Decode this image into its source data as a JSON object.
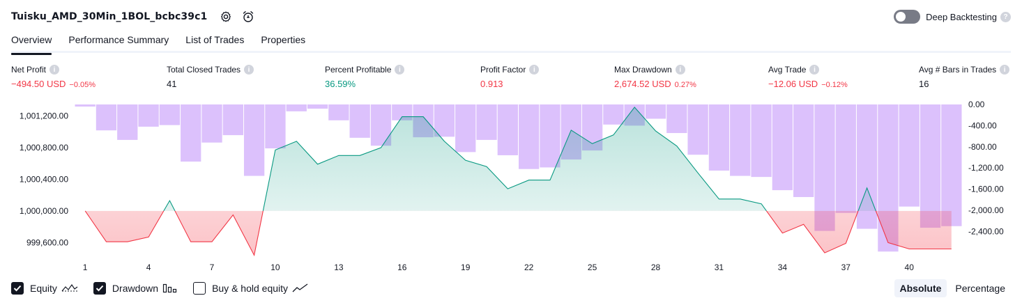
{
  "header": {
    "title": "Tuisku_AMD_30Min_1BOL_bcbc39c1",
    "settings_icon": "gear-icon",
    "alert_icon": "alarm-clock-add-icon",
    "deep_backtesting_label": "Deep Backtesting",
    "deep_backtesting_enabled": false
  },
  "tabs": [
    {
      "label": "Overview",
      "active": true
    },
    {
      "label": "Performance Summary",
      "active": false
    },
    {
      "label": "List of Trades",
      "active": false
    },
    {
      "label": "Properties",
      "active": false
    }
  ],
  "metrics": [
    {
      "label": "Net Profit",
      "value": "−494.50 USD",
      "pct": "−0.05%",
      "tone": "neg"
    },
    {
      "label": "Total Closed Trades",
      "value": "41",
      "pct": "",
      "tone": "neu"
    },
    {
      "label": "Percent Profitable",
      "value": "36.59%",
      "pct": "",
      "tone": "pos"
    },
    {
      "label": "Profit Factor",
      "value": "0.913",
      "pct": "",
      "tone": "neg"
    },
    {
      "label": "Max Drawdown",
      "value": "2,674.52 USD",
      "pct": "0.27%",
      "tone": "neg"
    },
    {
      "label": "Avg Trade",
      "value": "−12.06 USD",
      "pct": "−0.12%",
      "tone": "neg"
    },
    {
      "label": "Avg # Bars in Trades",
      "value": "16",
      "pct": "",
      "tone": "neu"
    }
  ],
  "chart_data": {
    "type": "line",
    "x_ticks": [
      "1",
      "4",
      "7",
      "10",
      "13",
      "16",
      "19",
      "22",
      "25",
      "28",
      "31",
      "34",
      "37",
      "40"
    ],
    "y_left_ticks": [
      "1,001,200.00",
      "1,000,800.00",
      "1,000,400.00",
      "1,000,000.00",
      "999,600.00"
    ],
    "y_right_ticks": [
      "0.00",
      "-400.00",
      "-800.00",
      "-1,200.00",
      "-1,600.00",
      "-2,000.00",
      "-2,400.00"
    ],
    "baseline": 1000000,
    "ylim_left": [
      999480,
      1001345
    ],
    "ylim_right": [
      -2790,
      0
    ],
    "series": [
      {
        "name": "Equity",
        "color_up": "#089981",
        "color_down": "#f23645",
        "x": [
          1,
          2,
          3,
          4,
          5,
          6,
          7,
          8,
          9,
          10,
          11,
          12,
          13,
          14,
          15,
          16,
          17,
          18,
          19,
          20,
          21,
          22,
          23,
          24,
          25,
          26,
          27,
          28,
          29,
          30,
          31,
          32,
          33,
          34,
          35,
          36,
          37,
          38,
          39,
          40,
          41,
          42
        ],
        "values": [
          1000000,
          999610,
          999610,
          999670,
          1000130,
          999610,
          999610,
          999950,
          999440,
          1000770,
          1000880,
          1000590,
          1000700,
          1000700,
          1000800,
          1001190,
          1001190,
          1000880,
          1000640,
          1000560,
          1000280,
          1000390,
          1000390,
          1001020,
          1000850,
          1000960,
          1001310,
          1001010,
          1000820,
          1000480,
          1000150,
          1000150,
          1000090,
          999720,
          999830,
          999470,
          999590,
          1000290,
          999600,
          999520,
          999520,
          999520
        ]
      },
      {
        "name": "Drawdown",
        "color": "#d6b6fb",
        "values": [
          -40,
          -490,
          -670,
          -420,
          -390,
          -1080,
          -720,
          -580,
          -1350,
          -830,
          -130,
          -80,
          -300,
          -630,
          -780,
          -300,
          -620,
          -610,
          -900,
          -670,
          -960,
          -1220,
          -1190,
          -1040,
          -870,
          -380,
          -400,
          -270,
          -540,
          -950,
          -1250,
          -1350,
          -1370,
          -1620,
          -1750,
          -2390,
          -2050,
          -2350,
          -2780,
          -1930,
          -2330,
          -2300
        ]
      }
    ]
  },
  "legend": [
    {
      "label": "Equity",
      "checked": true,
      "icon": "equity-line-icon"
    },
    {
      "label": "Drawdown",
      "checked": true,
      "icon": "drawdown-bars-icon"
    },
    {
      "label": "Buy & hold equity",
      "checked": false,
      "icon": "buy-hold-line-icon"
    }
  ],
  "view_modes": [
    {
      "label": "Absolute",
      "active": true
    },
    {
      "label": "Percentage",
      "active": false
    }
  ]
}
